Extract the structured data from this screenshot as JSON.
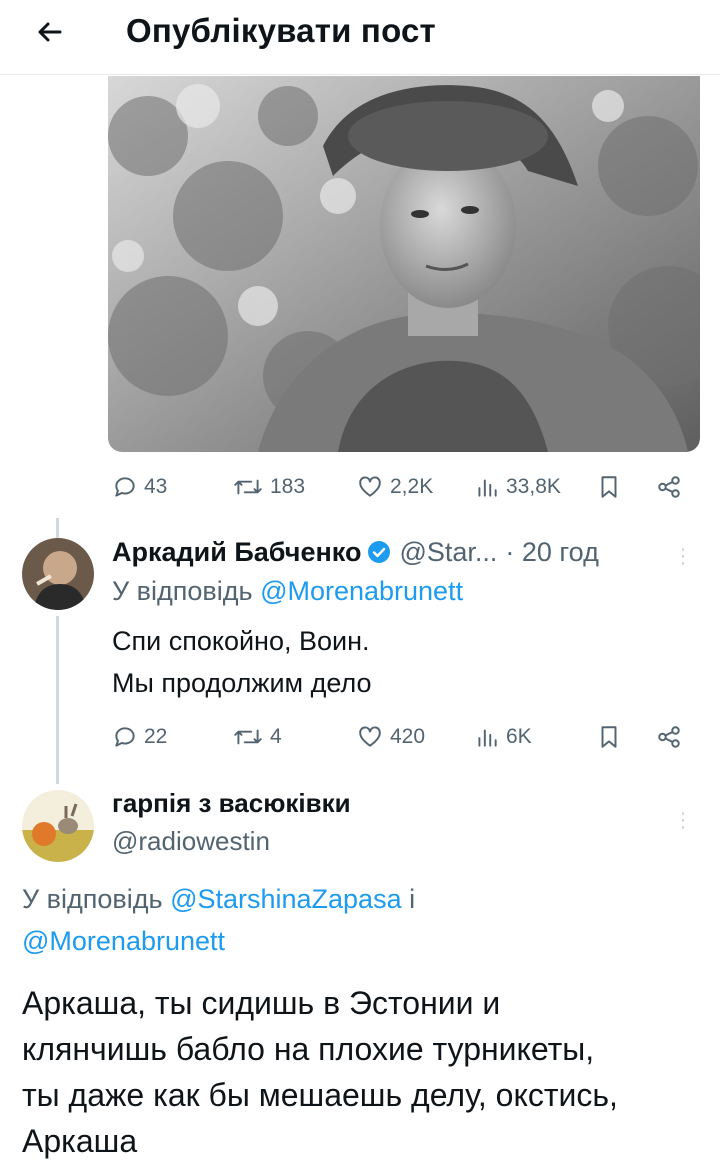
{
  "header": {
    "title": "Опублікувати пост"
  },
  "post_actions": {
    "replies": "43",
    "reposts": "183",
    "likes": "2,2K",
    "views": "33,8K"
  },
  "reply1": {
    "name": "Аркадий Бабченко",
    "handle": "@Star...",
    "time": "· 20 год",
    "reply_prefix": "У відповідь ",
    "reply_to": "@Morenabrunett",
    "lines": [
      "Спи спокойно, Воин.",
      "Мы продолжим дело"
    ],
    "actions": {
      "replies": "22",
      "reposts": "4",
      "likes": "420",
      "views": "6K"
    }
  },
  "reply2": {
    "name": "гарпія з васюківки",
    "handle": "@radiowestin",
    "reply_prefix": "У відповідь ",
    "reply_to_1": "@StarshinaZapasa",
    "reply_and": " і",
    "reply_to_2": "@Morenabrunett",
    "lines": [
      "Аркаша, ты сидишь в Эстонии и",
      "клянчишь бабло на плохие турникеты,",
      "ты даже как бы мешаешь делу, окстись,",
      "Аркаша"
    ]
  },
  "colors": {
    "accent": "#1d9bf0",
    "muted": "#536471",
    "verified": "#1d9bf0"
  },
  "icons": [
    "back-arrow-icon",
    "reply-icon",
    "repost-icon",
    "like-icon",
    "views-icon",
    "bookmark-icon",
    "share-icon",
    "verified-icon",
    "more-icon"
  ]
}
